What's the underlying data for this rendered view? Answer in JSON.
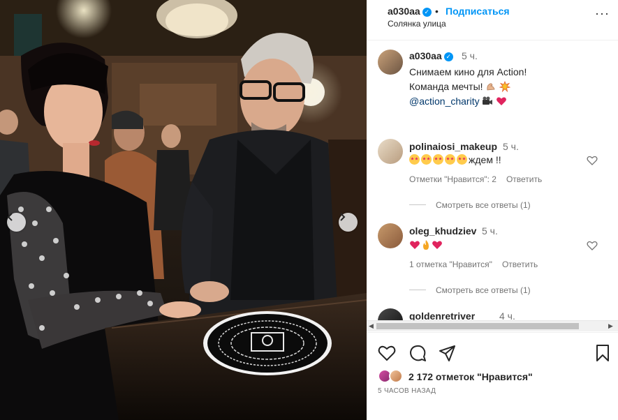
{
  "post": {
    "username": "a030aa",
    "follow_label": "Подписаться",
    "location": "Солянка улица",
    "dot": "•",
    "more": "···"
  },
  "caption": {
    "username": "a030aa",
    "time": "5 ч.",
    "line1": "Снимаем кино для Action!",
    "line2": "Команда мечты!",
    "mention": "@action_charity"
  },
  "comments": [
    {
      "username": "polinaiosi_makeup",
      "time": "5 ч.",
      "text": "ждем !!",
      "likes_label": "Отметки \"Нравится\": 2",
      "reply_label": "Ответить",
      "view_replies": "Смотреть все ответы (1)"
    },
    {
      "username": "oleg_khudziev",
      "time": "5 ч.",
      "text": "",
      "likes_label": "1 отметка \"Нравится\"",
      "reply_label": "Ответить",
      "view_replies": "Смотреть все ответы (1)"
    },
    {
      "username": "goldenretriver",
      "time": "4 ч."
    }
  ],
  "footer": {
    "likes_text": "2 172 отметок \"Нравится\"",
    "time_ago": "5 ЧАСОВ НАЗАД"
  },
  "icons": {
    "verified": "verified-badge-icon",
    "like": "heart-icon",
    "comment": "comment-icon",
    "share": "share-icon",
    "save": "bookmark-icon"
  },
  "colors": {
    "accent": "#0095f6",
    "mention": "#00376b",
    "secondary_text": "#737373"
  }
}
